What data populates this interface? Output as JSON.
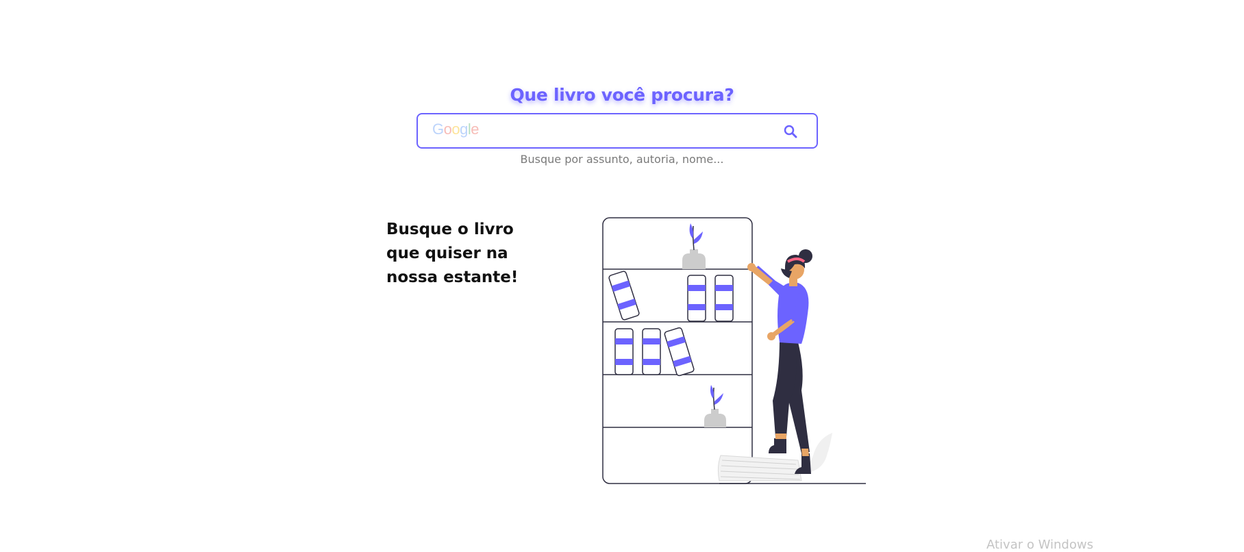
{
  "search": {
    "heading": "Que livro você procura?",
    "placeholder": "",
    "logo_letters": [
      "G",
      "o",
      "o",
      "g",
      "l",
      "e"
    ],
    "hint": "Busque por assunto, autoria, nome..."
  },
  "hero": {
    "tagline_lines": [
      "Busque o livro",
      "que quiser na",
      "nossa estante!"
    ]
  },
  "watermark": "Ativar o Windows",
  "colors": {
    "accent": "#6c63ff",
    "illustration_dark": "#2f2e41",
    "skin": "#e8a565",
    "headband": "#ff6584",
    "vase": "#cccccc",
    "google_blue": "#4285f4",
    "google_red": "#ea4335",
    "google_yellow": "#fbbc05",
    "google_green": "#34a853"
  },
  "icons": {
    "search_button": "search-icon"
  }
}
